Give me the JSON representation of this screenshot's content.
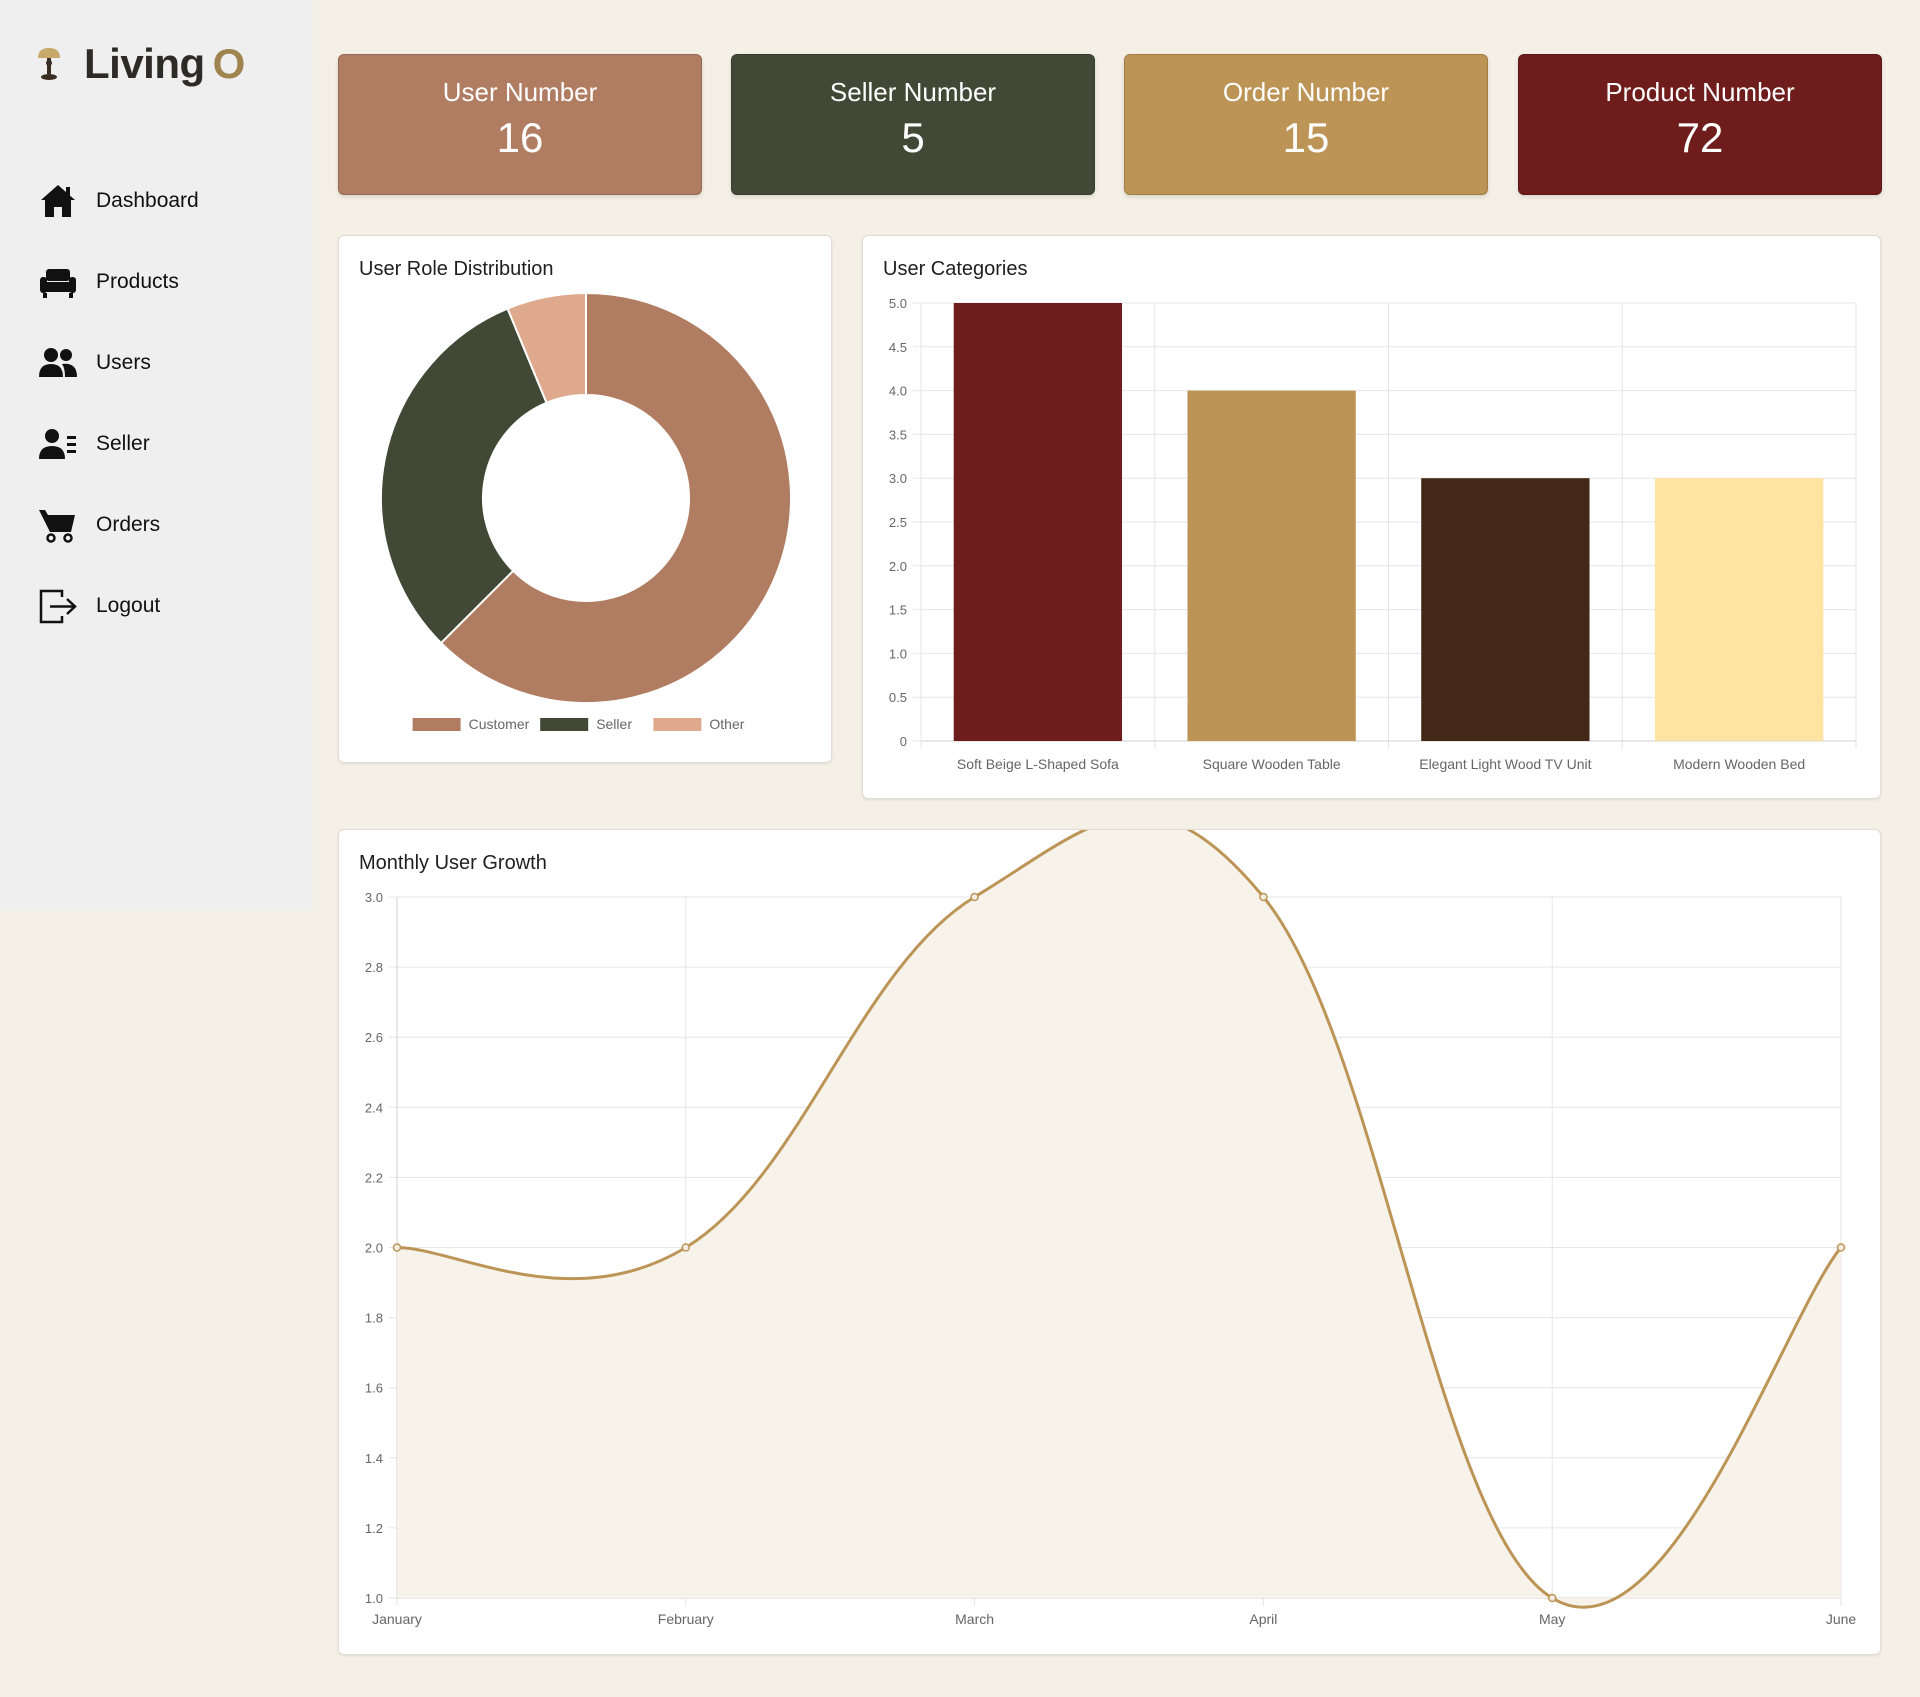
{
  "brand": {
    "name": "Living",
    "mark": "O"
  },
  "nav": [
    {
      "label": "Dashboard",
      "icon": "home-icon"
    },
    {
      "label": "Products",
      "icon": "sofa-icon"
    },
    {
      "label": "Users",
      "icon": "users-icon"
    },
    {
      "label": "Seller",
      "icon": "seller-icon"
    },
    {
      "label": "Orders",
      "icon": "cart-icon"
    },
    {
      "label": "Logout",
      "icon": "logout-icon"
    }
  ],
  "stats": [
    {
      "title": "User Number",
      "value": "16",
      "color": "#b07c62"
    },
    {
      "title": "Seller Number",
      "value": "5",
      "color": "#414936"
    },
    {
      "title": "Order Number",
      "value": "15",
      "color": "#bc9556"
    },
    {
      "title": "Product Number",
      "value": "72",
      "color": "#6e1c1c"
    }
  ],
  "chart_data": [
    {
      "type": "pie",
      "variant": "doughnut",
      "title": "User Role Distribution",
      "categories": [
        "Customer",
        "Seller",
        "Other"
      ],
      "values": [
        10,
        5,
        1
      ],
      "colors": [
        "#b07c62",
        "#414936",
        "#dfa98e"
      ],
      "legend": "bottom"
    },
    {
      "type": "bar",
      "title": "User Categories",
      "categories": [
        "Soft Beige L-Shaped Sofa",
        "Square Wooden Table",
        "Elegant Light Wood TV Unit",
        "Modern Wooden Bed"
      ],
      "values": [
        5,
        4,
        3,
        3
      ],
      "colors": [
        "#6e1c1c",
        "#bc9556",
        "#432818",
        "#ffe3a1"
      ],
      "ylim": [
        0,
        5
      ],
      "yticks": [
        "0",
        "0.5",
        "1.0",
        "1.5",
        "2.0",
        "2.5",
        "3.0",
        "3.5",
        "4.0",
        "4.5",
        "5.0"
      ],
      "grid": true
    },
    {
      "type": "line",
      "title": "Monthly User Growth",
      "categories": [
        "January",
        "February",
        "March",
        "April",
        "May",
        "June"
      ],
      "values": [
        2,
        2,
        3,
        3,
        1,
        2
      ],
      "color": "#bc9556",
      "fill": "#f7f3eb",
      "ylim": [
        1,
        3
      ],
      "yticks": [
        "1.0",
        "1.2",
        "1.4",
        "1.6",
        "1.8",
        "2.0",
        "2.2",
        "2.4",
        "2.6",
        "2.8",
        "3.0"
      ],
      "grid": true
    }
  ]
}
